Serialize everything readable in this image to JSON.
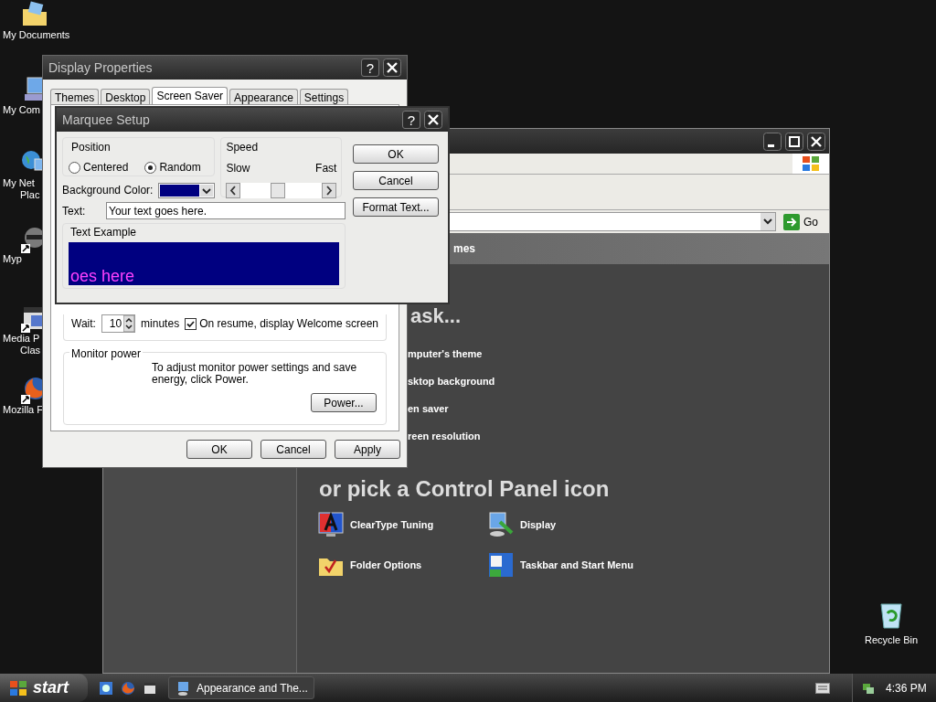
{
  "desktop_icons": [
    {
      "lines": [
        "My Documents"
      ],
      "kind": "documents"
    },
    {
      "lines": [
        "My Com"
      ],
      "kind": "computer"
    },
    {
      "lines": [
        "My Net",
        "Plac"
      ],
      "kind": "network"
    },
    {
      "lines": [
        "Myp"
      ],
      "kind": "raccoon"
    },
    {
      "lines": [
        "Media P",
        "Clas"
      ],
      "kind": "media"
    },
    {
      "lines": [
        "Mozilla F"
      ],
      "kind": "firefox"
    }
  ],
  "recycle_bin": {
    "label": "Recycle Bin"
  },
  "control_panel": {
    "header": "mes",
    "go_label": "Go",
    "task_heading": "ask...",
    "tasks": [
      "mputer's theme",
      "sktop background",
      "en saver",
      "reen resolution"
    ],
    "icons_heading": "or pick a Control Panel icon",
    "icons": [
      {
        "label": "ClearType Tuning",
        "kind": "cleartype"
      },
      {
        "label": "Display",
        "kind": "display"
      },
      {
        "label": "Folder Options",
        "kind": "folder"
      },
      {
        "label": "Taskbar and Start Menu",
        "kind": "taskbar"
      }
    ]
  },
  "display_properties": {
    "title": "Display Properties",
    "help": "?",
    "tabs": [
      {
        "label": "Themes",
        "selected": false
      },
      {
        "label": "Desktop",
        "selected": false
      },
      {
        "label": "Screen Saver",
        "selected": true
      },
      {
        "label": "Appearance",
        "selected": false
      },
      {
        "label": "Settings",
        "selected": false
      }
    ],
    "wait_label": "Wait:",
    "wait_value": "10",
    "minutes_label": "minutes",
    "welcome": {
      "label": "On resume, display Welcome screen",
      "checked": true
    },
    "monitor_group": "Monitor power",
    "monitor_text": "To adjust monitor power settings and save energy, click Power.",
    "power_button": "Power...",
    "buttons": [
      "OK",
      "Cancel",
      "Apply"
    ]
  },
  "marquee": {
    "title": "Marquee Setup",
    "help": "?",
    "position_group": "Position",
    "positions": [
      {
        "label": "Centered",
        "selected": false
      },
      {
        "label": "Random",
        "selected": true
      }
    ],
    "speed_group": "Speed",
    "slow": "Slow",
    "fast": "Fast",
    "speed": {
      "level": 0.45
    },
    "bg_label": "Background Color:",
    "text_label": "Text:",
    "text_value": "Your text goes here.",
    "example_group": "Text Example",
    "example_text": "oes here",
    "buttons": [
      "OK",
      "Cancel",
      "Format Text..."
    ]
  },
  "taskbar": {
    "start": "start",
    "task": "Appearance and The...",
    "clock": "4:36 PM"
  }
}
